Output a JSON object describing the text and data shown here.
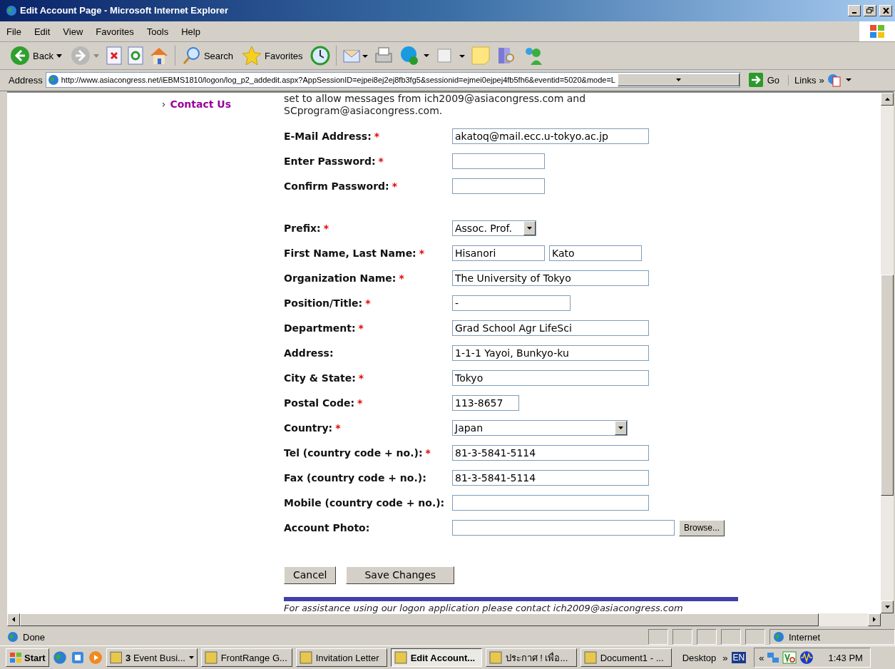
{
  "window": {
    "title": "Edit Account Page - Microsoft Internet Explorer"
  },
  "menu": [
    "File",
    "Edit",
    "View",
    "Favorites",
    "Tools",
    "Help"
  ],
  "toolbar": {
    "back": "Back",
    "search": "Search",
    "favorites": "Favorites"
  },
  "address_bar": {
    "label": "Address",
    "url": "http://www.asiacongress.net/iEBMS1810/logon/log_p2_addedit.aspx?AppSessionID=ejpei8ej2ej8fb3fg5&sessionid=ejmei0ejpej4fb5fh6&eventid=5020&mode=L",
    "go": "Go",
    "links": "Links",
    "links_more": "»"
  },
  "sidebar": {
    "bullet": "›",
    "link": "Contact Us"
  },
  "intro": [
    "set to allow messages from ich2009@asiacongress.com and",
    "SCprogram@asiacongress.com."
  ],
  "form_groups": [
    [
      {
        "label": "E-Mail Address:",
        "required": true,
        "kind": "text",
        "values": [
          "akatoq@mail.ecc.u-tokyo.ac.jp"
        ]
      },
      {
        "label": "Enter Password:",
        "required": true,
        "kind": "text"
      },
      {
        "label": "Confirm Password:",
        "required": true,
        "kind": "text"
      }
    ],
    [
      {
        "label": "Prefix:",
        "required": true,
        "kind": "select",
        "values": [
          "Assoc. Prof."
        ]
      },
      {
        "label": "First Name, Last Name:",
        "required": true,
        "kind": "text",
        "values": [
          "Hisanori",
          "Kato"
        ]
      },
      {
        "label": "Organization Name:",
        "required": true,
        "kind": "text",
        "values": [
          "The University of Tokyo"
        ]
      },
      {
        "label": "Position/Title:",
        "required": true,
        "kind": "text",
        "values": [
          "-"
        ]
      },
      {
        "label": "Department:",
        "required": true,
        "kind": "text",
        "values": [
          "Grad School Agr LifeSci"
        ]
      },
      {
        "label": "Address:",
        "required": false,
        "kind": "text",
        "values": [
          "1-1-1 Yayoi, Bunkyo-ku"
        ]
      },
      {
        "label": "City & State:",
        "required": true,
        "kind": "text",
        "values": [
          "Tokyo"
        ]
      },
      {
        "label": "Postal Code:",
        "required": true,
        "kind": "text",
        "values": [
          "113-8657"
        ]
      },
      {
        "label": "Country:",
        "required": true,
        "kind": "select",
        "values": [
          "Japan"
        ]
      },
      {
        "label": "Tel (country code + no.):",
        "required": true,
        "kind": "text",
        "values": [
          "81-3-5841-5114"
        ]
      },
      {
        "label": "Fax (country code + no.):",
        "required": false,
        "kind": "text",
        "values": [
          "81-3-5841-5114"
        ]
      },
      {
        "label": "Mobile (country code + no.):",
        "required": false,
        "kind": "text"
      },
      {
        "label": "Account Photo:",
        "required": false,
        "kind": "file",
        "button": "Browse..."
      }
    ]
  ],
  "required_mark": "*",
  "buttons": {
    "cancel": "Cancel",
    "save": "Save Changes"
  },
  "footer_note": "For assistance using our logon application please contact ich2009@asiacongress.com",
  "status_bar": {
    "text": "Done",
    "zone": "Internet"
  },
  "taskbar": {
    "start": "Start",
    "tasks": [
      {
        "label": "**3** Event Busi...",
        "selected": false,
        "dropdown": true
      },
      {
        "label": "FrontRange G...",
        "selected": false,
        "dropdown": false
      },
      {
        "label": "Invitation Letter",
        "selected": false,
        "dropdown": false
      },
      {
        "label": "Edit Account...",
        "selected": true,
        "dropdown": false
      },
      {
        "label": "ประกาศ ! เพื่อ...",
        "selected": false,
        "dropdown": false
      },
      {
        "label": "Document1 - ...",
        "selected": false,
        "dropdown": false
      }
    ],
    "desktop": "Desktop",
    "more": "»",
    "language": "EN",
    "tray_expand": "«",
    "clock": "1:43 PM"
  }
}
